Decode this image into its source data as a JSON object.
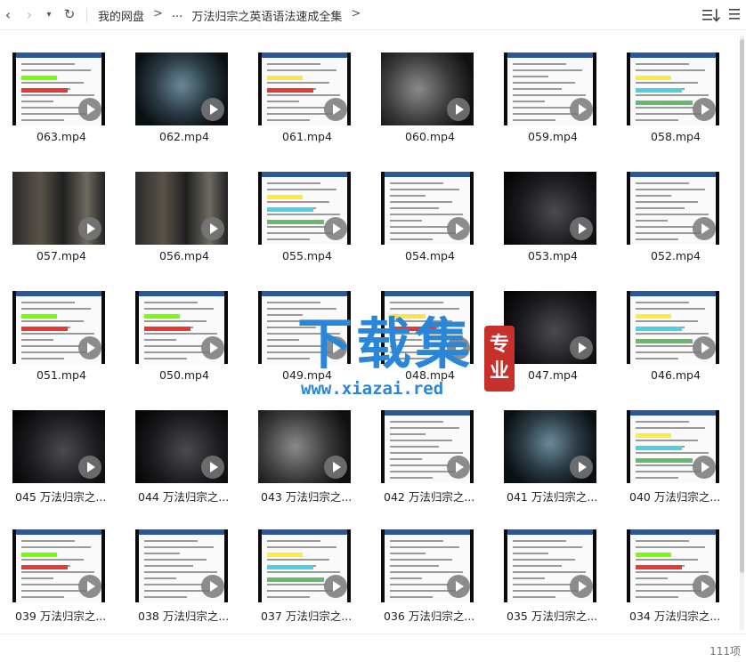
{
  "nav": {
    "back_glyph": "‹",
    "forward_glyph": "›",
    "dropdown_glyph": "▾",
    "refresh_glyph": "↻"
  },
  "breadcrumb": {
    "root": "我的网盘",
    "sep1": ">",
    "ellipsis": "...",
    "current": "万法归宗之英语语法速成全集",
    "sep2": ">"
  },
  "files": [
    {
      "name": "063.mp4",
      "style": "doc"
    },
    {
      "name": "062.mp4",
      "style": "face"
    },
    {
      "name": "061.mp4",
      "style": "doc-red"
    },
    {
      "name": "060.mp4",
      "style": "scene"
    },
    {
      "name": "059.mp4",
      "style": "doc-plain"
    },
    {
      "name": "058.mp4",
      "style": "doc-color"
    },
    {
      "name": "057.mp4",
      "style": "scene-people"
    },
    {
      "name": "056.mp4",
      "style": "scene-people"
    },
    {
      "name": "055.mp4",
      "style": "doc-color"
    },
    {
      "name": "054.mp4",
      "style": "doc-plain"
    },
    {
      "name": "053.mp4",
      "style": "scene-dark"
    },
    {
      "name": "052.mp4",
      "style": "doc-plain"
    },
    {
      "name": "051.mp4",
      "style": "doc"
    },
    {
      "name": "050.mp4",
      "style": "doc"
    },
    {
      "name": "049.mp4",
      "style": "doc-plain"
    },
    {
      "name": "048.mp4",
      "style": "doc-red"
    },
    {
      "name": "047.mp4",
      "style": "scene-dark"
    },
    {
      "name": "046.mp4",
      "style": "doc-color"
    },
    {
      "name": "045  万法归宗之...",
      "style": "scene-dark"
    },
    {
      "name": "044  万法归宗之...",
      "style": "scene-dark"
    },
    {
      "name": "043  万法归宗之...",
      "style": "scene"
    },
    {
      "name": "042  万法归宗之...",
      "style": "doc-plain"
    },
    {
      "name": "041  万法归宗之...",
      "style": "face"
    },
    {
      "name": "040  万法归宗之...",
      "style": "doc-color"
    },
    {
      "name": "039  万法归宗之...",
      "style": "doc"
    },
    {
      "name": "038  万法归宗之...",
      "style": "doc-plain"
    },
    {
      "name": "037  万法归宗之...",
      "style": "doc-color"
    },
    {
      "name": "036  万法归宗之...",
      "style": "doc-plain"
    },
    {
      "name": "035  万法归宗之...",
      "style": "doc-plain"
    },
    {
      "name": "034  万法归宗之...",
      "style": "doc"
    }
  ],
  "watermark": {
    "main": "下载集",
    "url": "www.xiazai.red",
    "seal_1": "专",
    "seal_2": "业"
  },
  "status": {
    "item_count": "111项"
  },
  "colors": {
    "accent": "#2a86d9",
    "seal": "#c8302b",
    "doc_bar": "#2b579a"
  }
}
